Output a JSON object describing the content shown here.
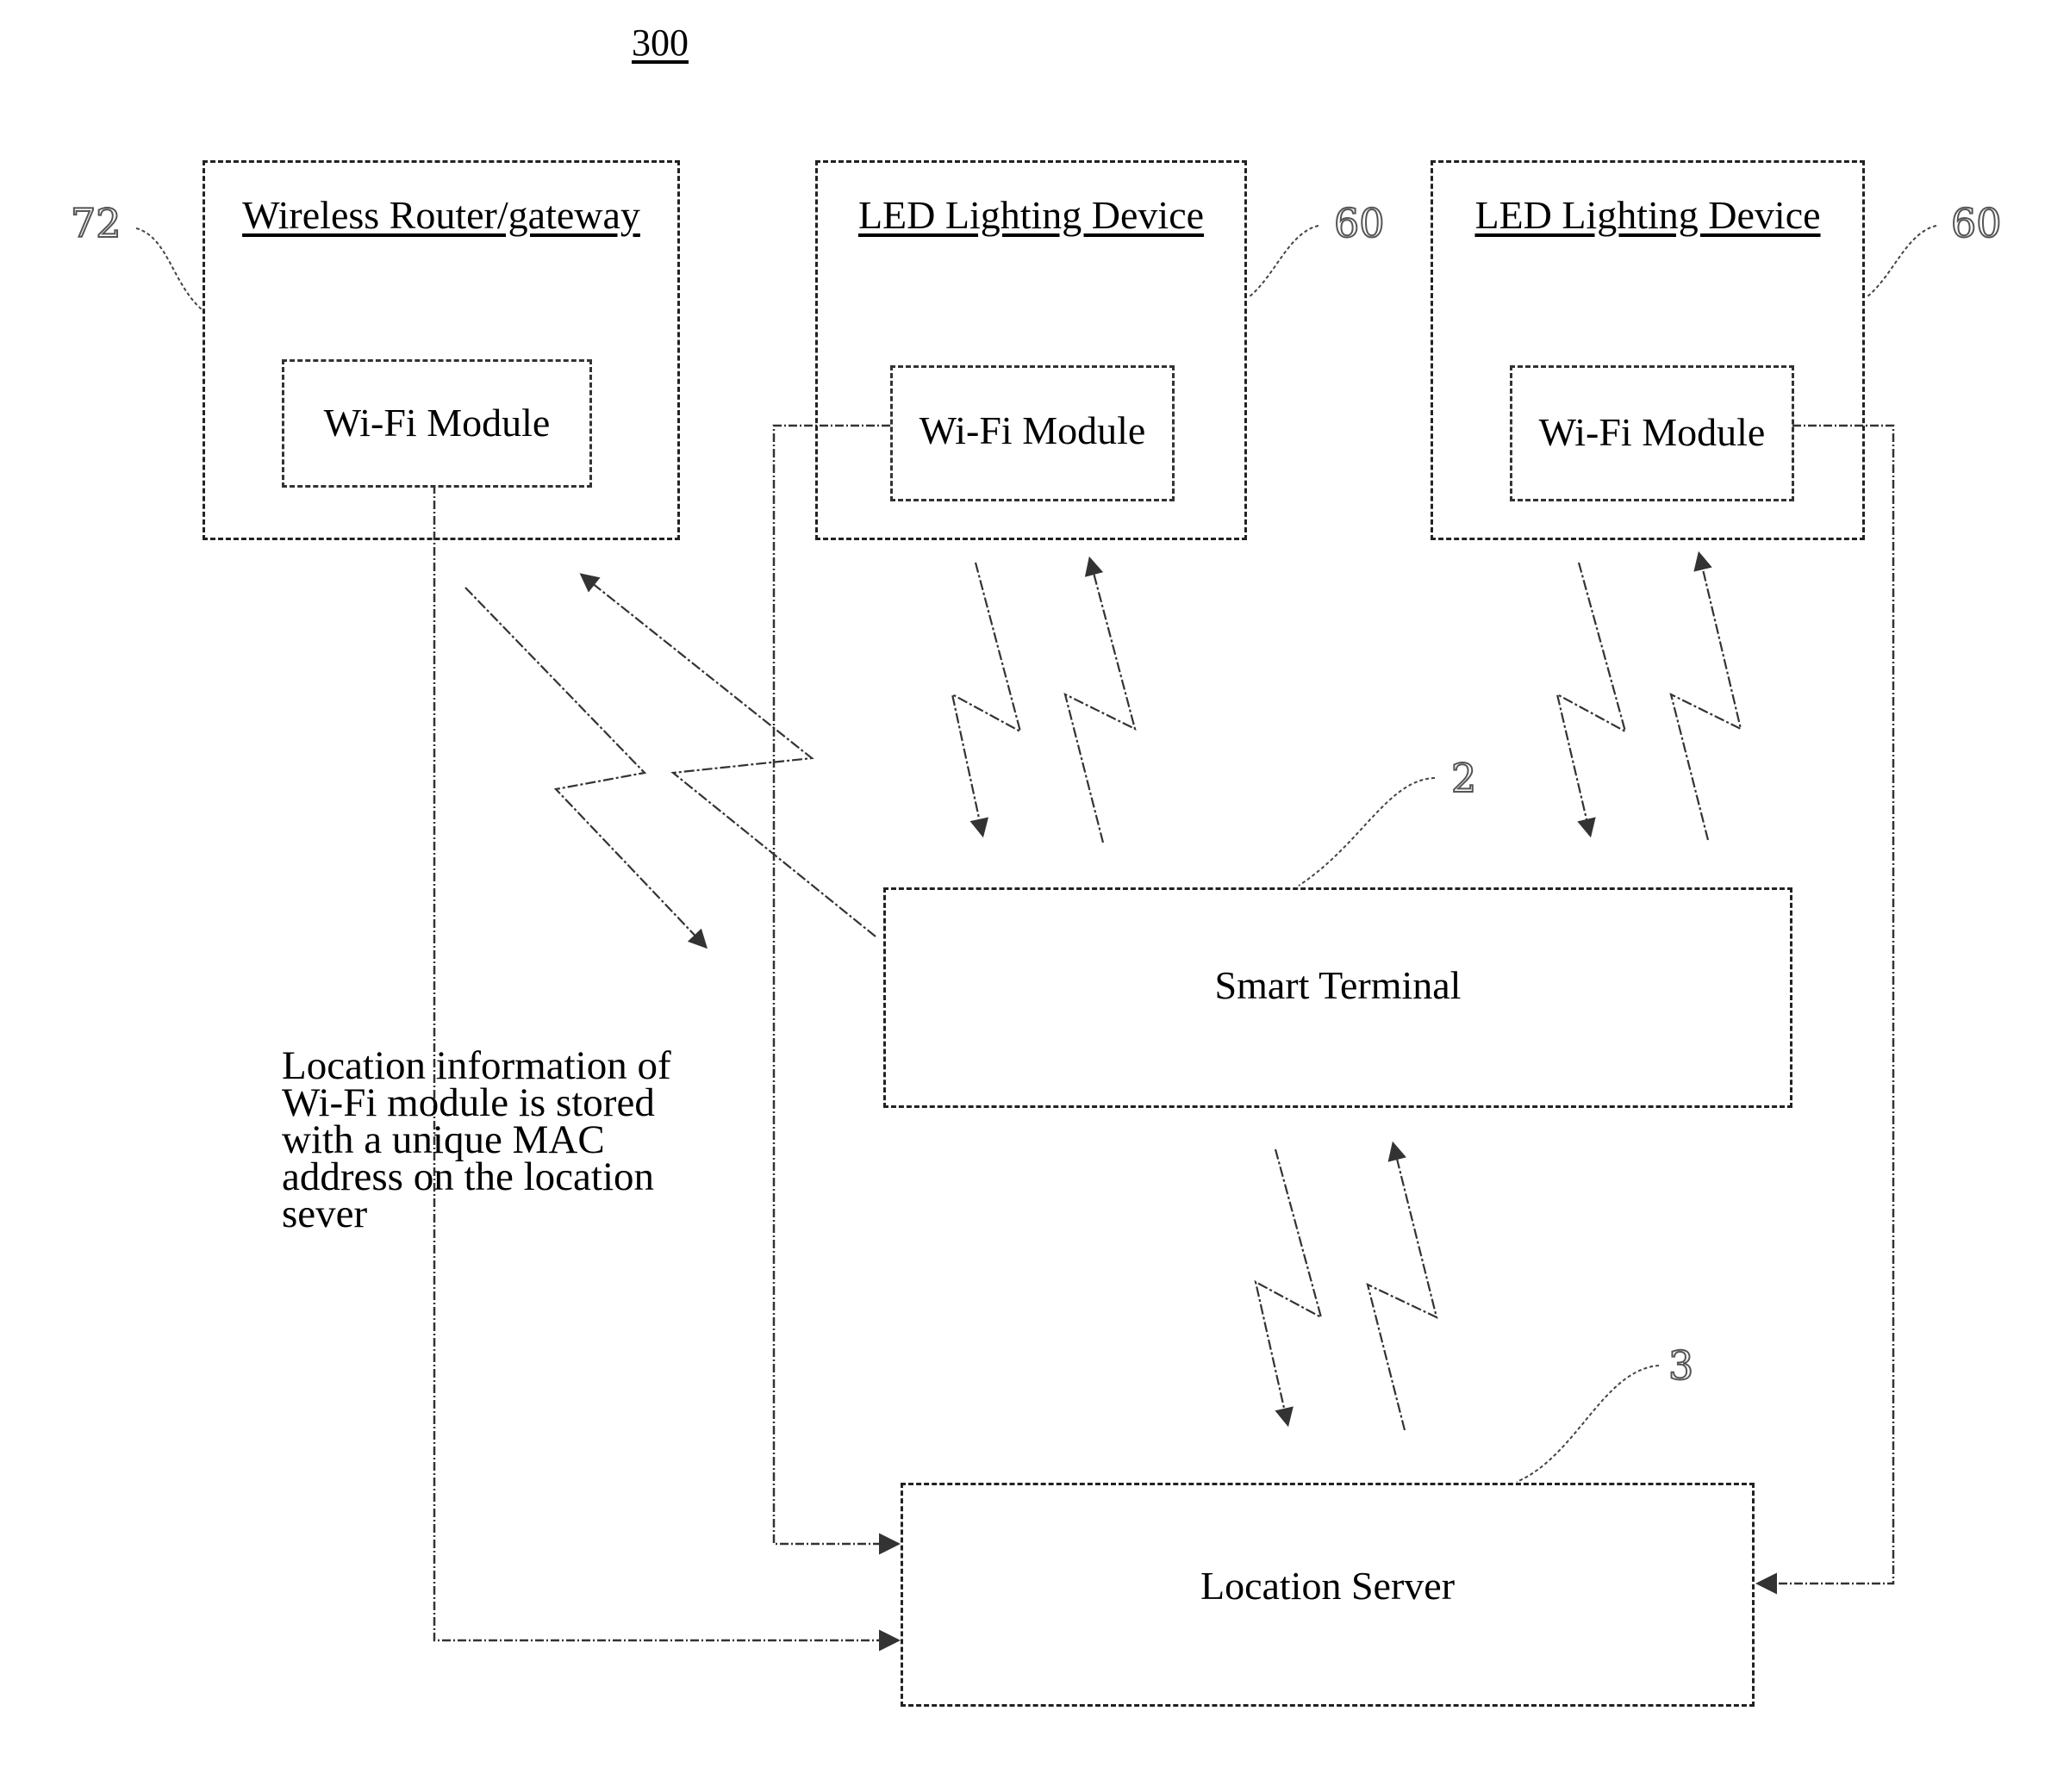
{
  "figure_number": "300",
  "nodes": {
    "router": {
      "title": "Wireless Router/gateway",
      "module": "Wi-Fi Module",
      "ref": "72"
    },
    "led1": {
      "title": "LED Lighting Device",
      "module": "Wi-Fi Module",
      "ref": "60"
    },
    "led2": {
      "title": "LED Lighting Device",
      "module": "Wi-Fi Module",
      "ref": "60"
    },
    "terminal": {
      "label": "Smart Terminal",
      "ref": "2"
    },
    "server": {
      "label": "Location Server",
      "ref": "3"
    }
  },
  "note": {
    "lines": [
      "Location information of",
      "Wi-Fi module is stored",
      "with a unique MAC",
      "address on the location",
      "sever"
    ]
  },
  "connections": [
    {
      "from": "router",
      "to": "terminal",
      "type": "wireless-bidirectional"
    },
    {
      "from": "led1",
      "to": "terminal",
      "type": "wireless-bidirectional"
    },
    {
      "from": "led2",
      "to": "terminal",
      "type": "wireless-bidirectional"
    },
    {
      "from": "terminal",
      "to": "server",
      "type": "wireless-bidirectional"
    },
    {
      "from": "router.module",
      "to": "server",
      "type": "wired-dashed"
    },
    {
      "from": "led1.module",
      "to": "server",
      "type": "wired-dashed"
    },
    {
      "from": "led2.module",
      "to": "server",
      "type": "wired-dashed"
    }
  ]
}
